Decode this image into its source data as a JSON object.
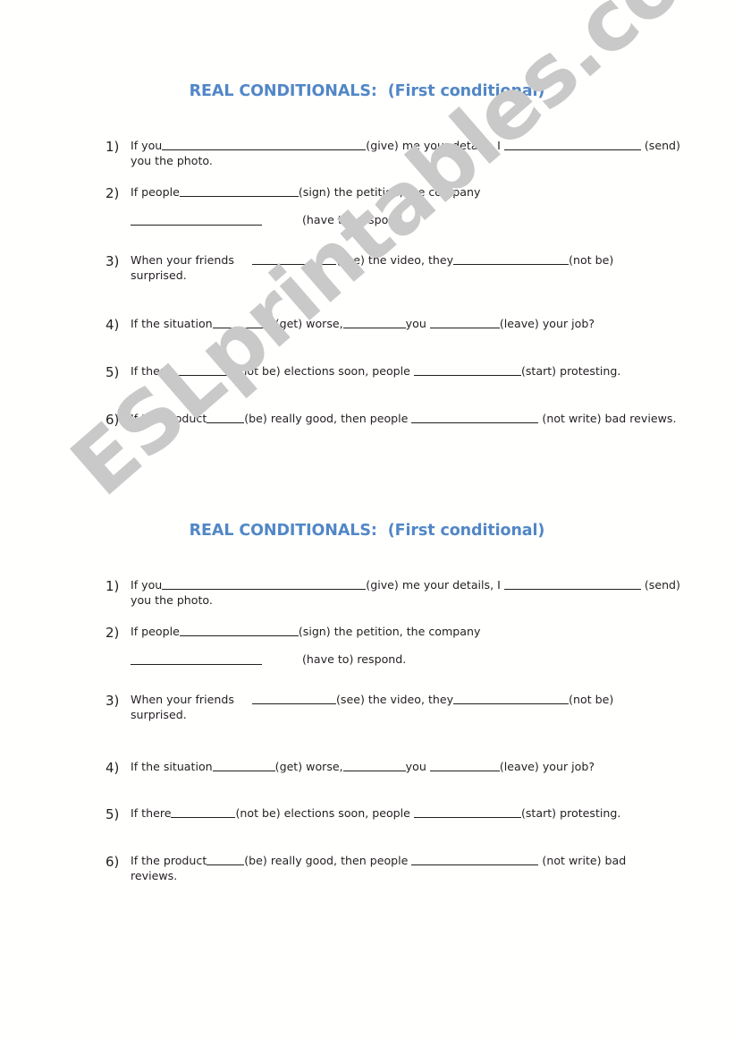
{
  "document": {
    "title": "REAL CONDITIONALS:  (First conditional)",
    "watermark": "ESLprintables.com",
    "title_color": "#5287c6",
    "text_color": "#231f20",
    "watermark_color": "#c9c9c9"
  },
  "blocks": [
    {
      "title": "REAL CONDITIONALS:  (First conditional)",
      "items": [
        {
          "number": "1)",
          "pre": "If you",
          "mid": "(give) me your details, I ",
          "post": " (send)",
          "line2": "you the photo."
        },
        {
          "number": "2)",
          "pre": "If people",
          "mid": "(sign) the petition, the company",
          "have_to": "(have to) respond."
        },
        {
          "number": "3)",
          "pre": "When your friends",
          "mid": "(see) the video, they",
          "post": "(not be)",
          "line2": "surprised."
        },
        {
          "number": "4)",
          "pre": "If the situation",
          "mid": "(get) worse,",
          "mid2": "you ",
          "post": "(leave) your job?"
        },
        {
          "number": "5)",
          "pre": "If there",
          "mid": "(not be) elections soon, people ",
          "post": "(start) protesting."
        },
        {
          "number": "6)",
          "pre": "If the product",
          "mid": "(be) really good, then people ",
          "post": " (not write) bad reviews."
        }
      ]
    },
    {
      "title": "REAL CONDITIONALS:  (First conditional)",
      "items": [
        {
          "number": "1)",
          "pre": "If you",
          "mid": "(give) me your details, I ",
          "post": " (send)",
          "line2": "you the photo."
        },
        {
          "number": "2)",
          "pre": "If people",
          "mid": "(sign) the petition, the company",
          "have_to": "(have to) respond."
        },
        {
          "number": "3)",
          "pre": "When your friends",
          "mid": "(see) the video, they",
          "post": "(not be)",
          "line2": "surprised."
        },
        {
          "number": "4)",
          "pre": "If the situation",
          "mid": "(get) worse,",
          "mid2": "you ",
          "post": "(leave) your job?"
        },
        {
          "number": "5)",
          "pre": "If there",
          "mid": "(not be) elections soon, people ",
          "post": "(start) protesting."
        },
        {
          "number": "6)",
          "pre": "If the product",
          "mid": "(be) really good, then people ",
          "post": " (not write) bad",
          "line2": "reviews."
        }
      ]
    }
  ]
}
